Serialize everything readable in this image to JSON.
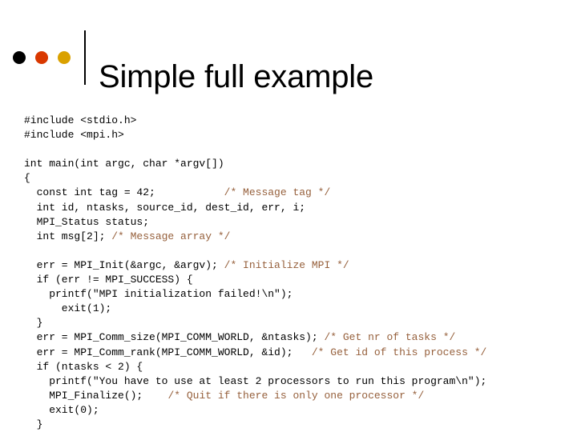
{
  "slide": {
    "title": "Simple full example",
    "background_color": "#ffffff",
    "text_color": "#000000"
  },
  "header": {
    "dots": [
      {
        "name": "bullet-dot-black",
        "color": "#000000"
      },
      {
        "name": "bullet-dot-red",
        "color": "#d93800"
      },
      {
        "name": "bullet-dot-gold",
        "color": "#daa100"
      }
    ],
    "divider_color": "#000000"
  },
  "code": {
    "language": "c",
    "comment_color": "#96603c",
    "lines": [
      {
        "code": "#include <stdio.h>",
        "comment": ""
      },
      {
        "code": "#include <mpi.h>",
        "comment": ""
      },
      {
        "code": "",
        "comment": ""
      },
      {
        "code": "int main(int argc, char *argv[])",
        "comment": ""
      },
      {
        "code": "{",
        "comment": ""
      },
      {
        "code": "  const int tag = 42;           ",
        "comment": "/* Message tag */"
      },
      {
        "code": "  int id, ntasks, source_id, dest_id, err, i;",
        "comment": ""
      },
      {
        "code": "  MPI_Status status;",
        "comment": ""
      },
      {
        "code": "  int msg[2]; ",
        "comment": "/* Message array */"
      },
      {
        "code": "",
        "comment": ""
      },
      {
        "code": "  err = MPI_Init(&argc, &argv); ",
        "comment": "/* Initialize MPI */"
      },
      {
        "code": "  if (err != MPI_SUCCESS) {",
        "comment": ""
      },
      {
        "code": "    printf(\"MPI initialization failed!\\n\");",
        "comment": ""
      },
      {
        "code": "      exit(1);",
        "comment": ""
      },
      {
        "code": "  }",
        "comment": ""
      },
      {
        "code": "  err = MPI_Comm_size(MPI_COMM_WORLD, &ntasks); ",
        "comment": "/* Get nr of tasks */"
      },
      {
        "code": "  err = MPI_Comm_rank(MPI_COMM_WORLD, &id);   ",
        "comment": "/* Get id of this process */"
      },
      {
        "code": "  if (ntasks < 2) {",
        "comment": ""
      },
      {
        "code": "    printf(\"You have to use at least 2 processors to run this program\\n\");",
        "comment": ""
      },
      {
        "code": "    MPI_Finalize();    ",
        "comment": "/* Quit if there is only one processor */"
      },
      {
        "code": "    exit(0);",
        "comment": ""
      },
      {
        "code": "  }",
        "comment": ""
      }
    ]
  }
}
